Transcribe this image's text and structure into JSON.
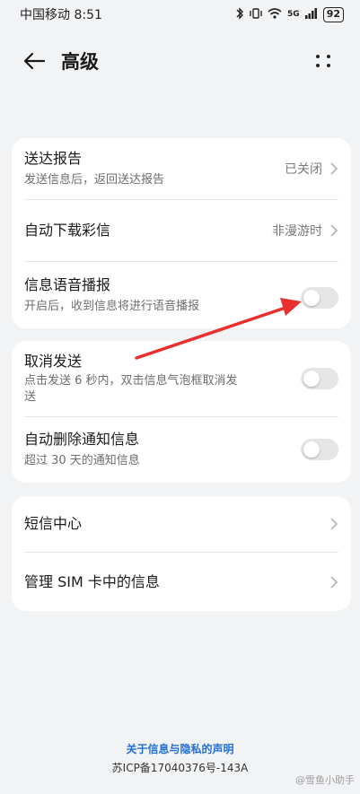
{
  "status_bar": {
    "carrier_time": "中国移动 8:51",
    "network": "5G",
    "battery": "92"
  },
  "header": {
    "title": "高级"
  },
  "card1": {
    "delivery_report": {
      "title": "送达报告",
      "subtitle": "发送信息后，返回送达报告",
      "value": "已关闭"
    },
    "auto_download_mms": {
      "title": "自动下载彩信",
      "value": "非漫游时"
    },
    "voice_broadcast": {
      "title": "信息语音播报",
      "subtitle": "开启后，收到信息将进行语音播报",
      "enabled": false
    }
  },
  "card2": {
    "cancel_send": {
      "title": "取消发送",
      "subtitle_line1": "点击发送 6 秒内，双击信息气泡框取消发",
      "subtitle_line2": "送",
      "enabled": false
    },
    "auto_delete_notifications": {
      "title": "自动删除通知信息",
      "subtitle": "超过 30 天的通知信息",
      "enabled": false
    }
  },
  "card3": {
    "sms_center": {
      "title": "短信中心"
    },
    "manage_sim": {
      "title": "管理 SIM 卡中的信息"
    }
  },
  "footer": {
    "privacy_link": "关于信息与隐私的声明",
    "icp": "苏ICP备17040376号-143A"
  },
  "watermark": "@雪鱼小助手",
  "colors": {
    "annotation_arrow": "#e8302f",
    "link": "#1f6fd6"
  }
}
